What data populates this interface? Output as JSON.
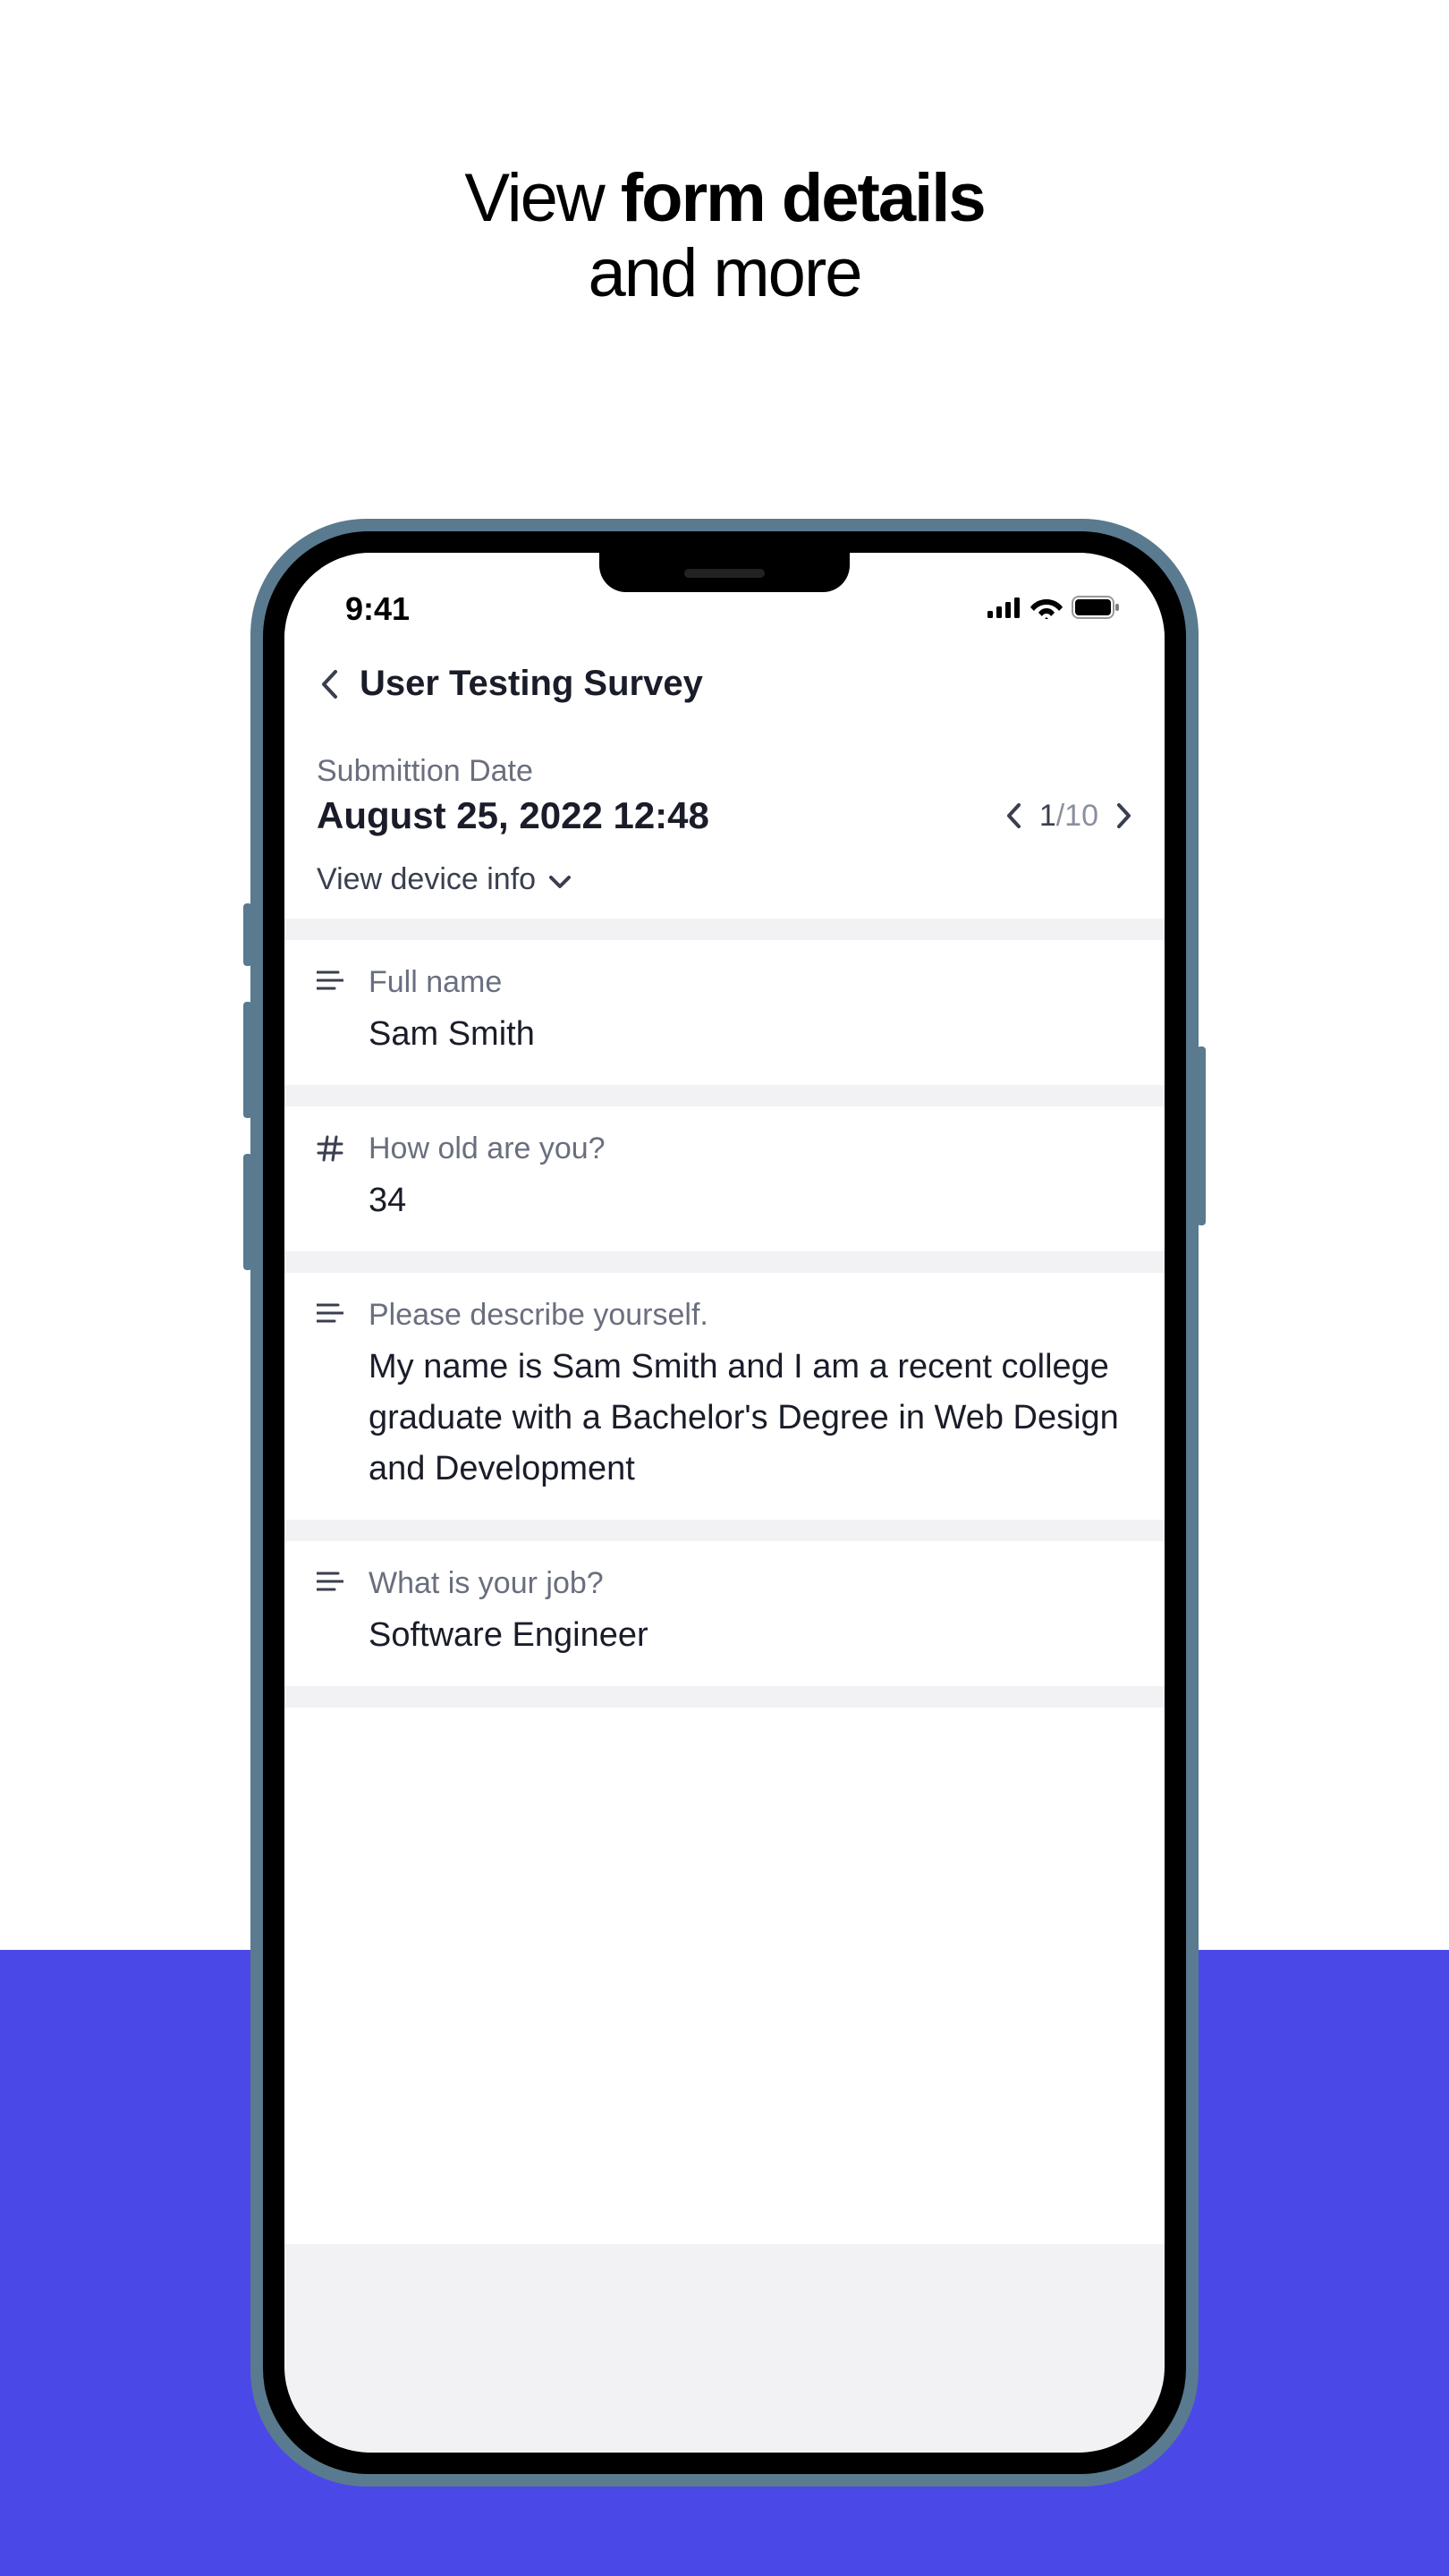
{
  "headline": {
    "part1": "View ",
    "bold": "form details",
    "part2": " and more"
  },
  "status_bar": {
    "time": "9:41"
  },
  "nav": {
    "title": "User Testing Survey"
  },
  "meta": {
    "label": "Submittion Date",
    "date": "August 25, 2022 12:48",
    "page_current": "1",
    "page_total": "/10",
    "device_info_label": "View device info"
  },
  "fields": [
    {
      "icon": "text",
      "label": "Full name",
      "value": "Sam Smith"
    },
    {
      "icon": "hash",
      "label": "How old are you?",
      "value": "34"
    },
    {
      "icon": "text",
      "label": "Please describe yourself.",
      "value": "My name is Sam Smith and I am a recent college graduate with a Bachelor's Degree in Web Design and Development"
    },
    {
      "icon": "text",
      "label": "What is your job?",
      "value": "Software Engineer"
    }
  ]
}
